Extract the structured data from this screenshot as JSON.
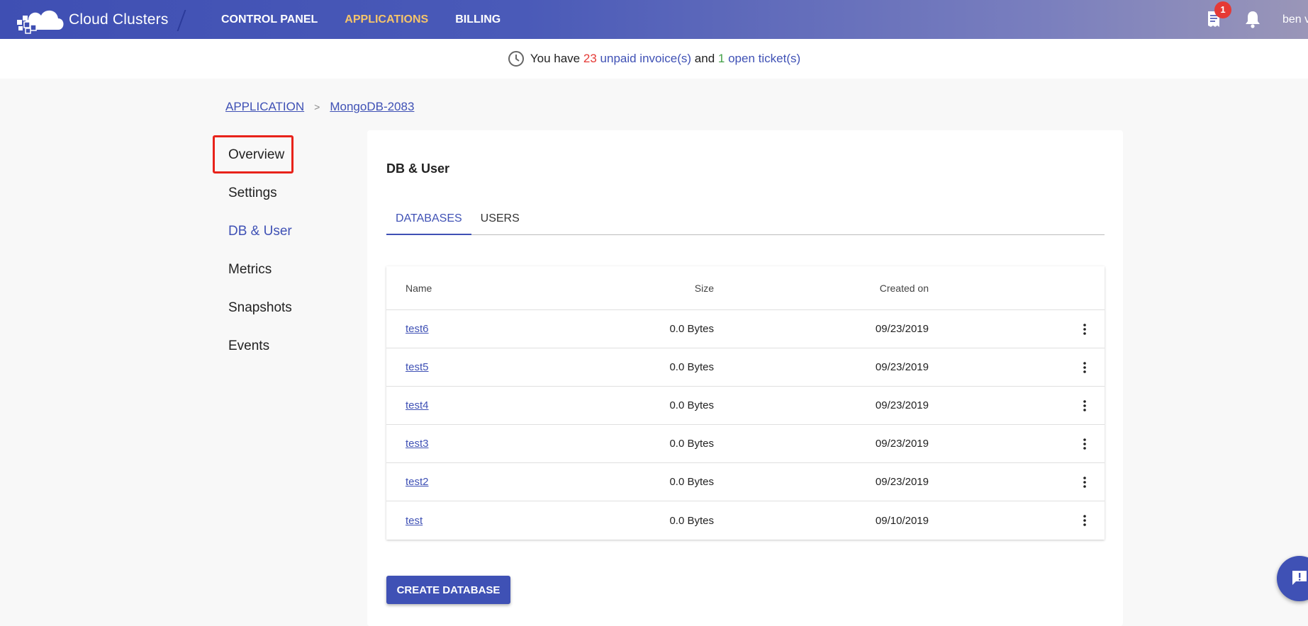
{
  "header": {
    "brand_name": "Cloud Clusters",
    "logo_icon": "cloud-logo-icon",
    "nav": [
      {
        "label": "CONTROL PANEL",
        "active": false
      },
      {
        "label": "APPLICATIONS",
        "active": true
      },
      {
        "label": "BILLING",
        "active": false
      }
    ],
    "invoice_badge": "1",
    "invoice_icon": "invoice-icon",
    "bell_icon": "bell-icon",
    "user_name": "ben v",
    "accent_active": "#f5c46a"
  },
  "notice": {
    "prefix": "You have",
    "invoice_count": "23",
    "invoice_text": "unpaid invoice(s)",
    "and": "and",
    "ticket_count": "1",
    "ticket_text": "open ticket(s)"
  },
  "breadcrumb": {
    "root": "APPLICATION",
    "separator": ">",
    "current": "MongoDB-2083"
  },
  "sidebar": {
    "items": [
      {
        "label": "Overview",
        "active": false,
        "highlighted": true
      },
      {
        "label": "Settings",
        "active": false
      },
      {
        "label": "DB & User",
        "active": true
      },
      {
        "label": "Metrics",
        "active": false
      },
      {
        "label": "Snapshots",
        "active": false
      },
      {
        "label": "Events",
        "active": false
      }
    ]
  },
  "main": {
    "title": "DB & User",
    "tabs": [
      {
        "label": "DATABASES",
        "active": true
      },
      {
        "label": "USERS",
        "active": false
      }
    ],
    "table": {
      "columns": [
        "Name",
        "Size",
        "Created on"
      ],
      "rows": [
        {
          "name": "test6",
          "size": "0.0 Bytes",
          "created": "09/23/2019"
        },
        {
          "name": "test5",
          "size": "0.0 Bytes",
          "created": "09/23/2019"
        },
        {
          "name": "test4",
          "size": "0.0 Bytes",
          "created": "09/23/2019"
        },
        {
          "name": "test3",
          "size": "0.0 Bytes",
          "created": "09/23/2019"
        },
        {
          "name": "test2",
          "size": "0.0 Bytes",
          "created": "09/23/2019"
        },
        {
          "name": "test",
          "size": "0.0 Bytes",
          "created": "09/10/2019"
        }
      ]
    },
    "create_button": "CREATE DATABASE"
  },
  "colors": {
    "primary": "#3f51b5",
    "danger": "#e53935",
    "success": "#43a047",
    "highlight_box": "#e8231b"
  }
}
